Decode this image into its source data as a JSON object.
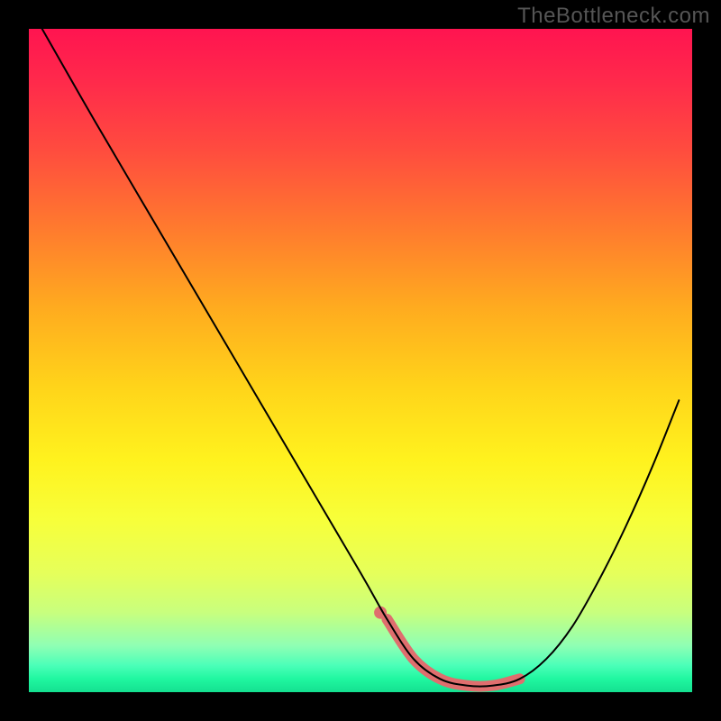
{
  "watermark": "TheBottleneck.com",
  "chart_data": {
    "type": "line",
    "title": "",
    "xlabel": "",
    "ylabel": "",
    "xlim": [
      0,
      100
    ],
    "ylim": [
      0,
      100
    ],
    "series": [
      {
        "name": "bottleneck-curve",
        "x": [
          2,
          10,
          20,
          30,
          40,
          50,
          54,
          58,
          62,
          66,
          70,
          74,
          78,
          82,
          86,
          90,
          94,
          98
        ],
        "values": [
          100,
          86,
          69,
          52,
          35,
          18,
          11,
          5,
          2,
          1,
          1,
          2,
          5,
          10,
          17,
          25,
          34,
          44
        ]
      }
    ],
    "highlight": {
      "name": "optimal-band",
      "x": [
        54,
        58,
        62,
        66,
        70,
        74
      ],
      "values": [
        11,
        5,
        2,
        1,
        1,
        2
      ]
    },
    "markers": [
      {
        "name": "left-marker",
        "x": 53,
        "y": 12
      }
    ],
    "colors": {
      "curve": "#000000",
      "highlight": "#df6e6e",
      "gradient_top": "#ff1450",
      "gradient_mid": "#fff21e",
      "gradient_bottom": "#14e090",
      "frame": "#000000"
    }
  }
}
